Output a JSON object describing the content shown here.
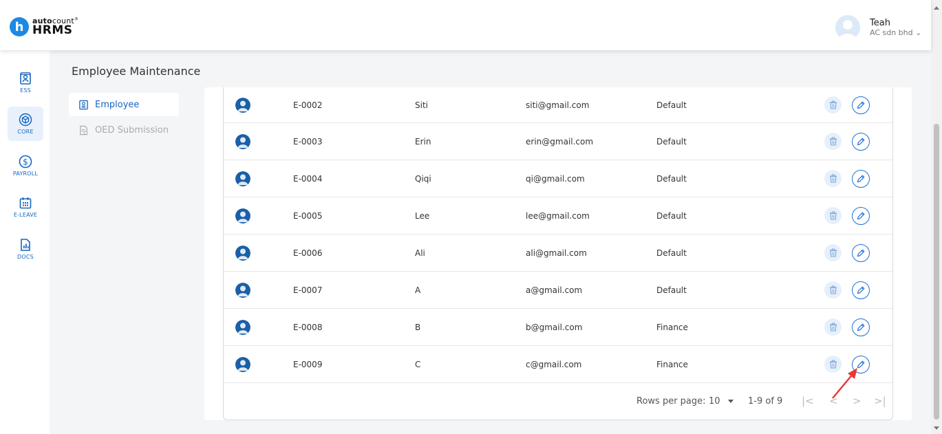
{
  "brand": {
    "top_bold": "auto",
    "top_light": "count",
    "top_mark": "®",
    "bottom": "HRMS",
    "initial": "h"
  },
  "user": {
    "name": "Teah",
    "company": "AC sdn bhd",
    "caret": "⌄"
  },
  "sidebar": {
    "items": [
      {
        "label": "ESS",
        "icon": "profile-card-icon",
        "active": false
      },
      {
        "label": "CORE",
        "icon": "cube-icon",
        "active": true
      },
      {
        "label": "PAYROLL",
        "icon": "dollar-circle-icon",
        "active": false
      },
      {
        "label": "E-LEAVE",
        "icon": "calendar-icon",
        "active": false
      },
      {
        "label": "DOCS",
        "icon": "document-chart-icon",
        "active": false
      }
    ]
  },
  "page": {
    "title": "Employee Maintenance"
  },
  "subnav": {
    "items": [
      {
        "label": "Employee",
        "icon": "employee-card-icon",
        "active": true
      },
      {
        "label": "OED Submission",
        "icon": "document-check-icon",
        "active": false
      }
    ]
  },
  "table": {
    "rows": [
      {
        "code": "E-0002",
        "name": "Siti",
        "email": "siti@gmail.com",
        "dept": "Default"
      },
      {
        "code": "E-0003",
        "name": "Erin",
        "email": "erin@gmail.com",
        "dept": "Default"
      },
      {
        "code": "E-0004",
        "name": "Qiqi",
        "email": "qi@gmail.com",
        "dept": "Default"
      },
      {
        "code": "E-0005",
        "name": "Lee",
        "email": "lee@gmail.com",
        "dept": "Default"
      },
      {
        "code": "E-0006",
        "name": "Ali",
        "email": "ali@gmail.com",
        "dept": "Default"
      },
      {
        "code": "E-0007",
        "name": "A",
        "email": "a@gmail.com",
        "dept": "Default"
      },
      {
        "code": "E-0008",
        "name": "B",
        "email": "b@gmail.com",
        "dept": "Finance"
      },
      {
        "code": "E-0009",
        "name": "C",
        "email": "c@gmail.com",
        "dept": "Finance"
      }
    ]
  },
  "pagination": {
    "rows_per_page_label": "Rows per page:",
    "rows_per_page_value": "10",
    "range": "1-9 of 9",
    "first": "|<",
    "prev": "<",
    "next": ">",
    "last": ">|"
  },
  "colors": {
    "accent": "#1e6fd9",
    "sidebar_label": "#1565c0",
    "annotation_arrow": "#e53935"
  }
}
